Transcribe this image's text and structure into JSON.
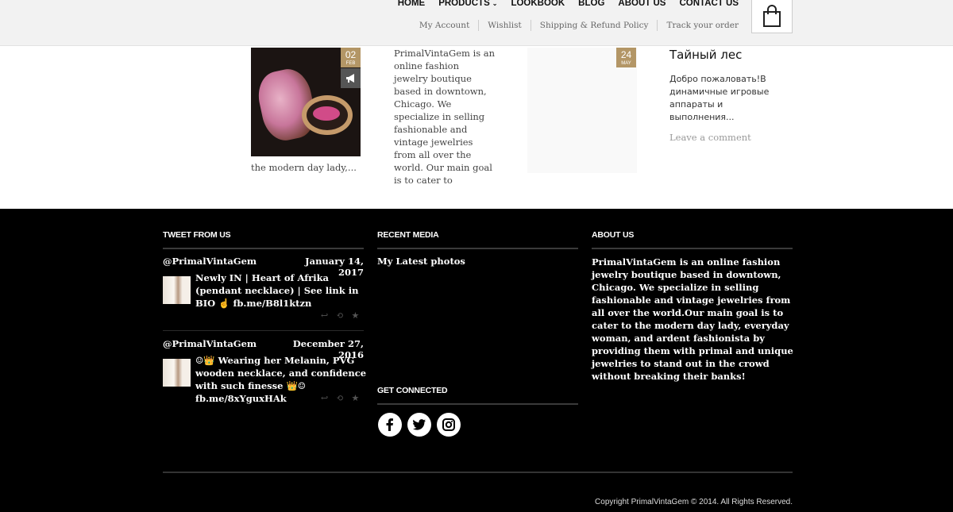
{
  "header": {
    "nav": [
      {
        "label": "HOME"
      },
      {
        "label": "PRODUCTS",
        "caret": "⌄"
      },
      {
        "label": "LOOKBOOK"
      },
      {
        "label": "BLOG"
      },
      {
        "label": "ABOUT US"
      },
      {
        "label": "CONTACT US"
      }
    ],
    "subnav": [
      {
        "label": "My Account"
      },
      {
        "label": "Wishlist"
      },
      {
        "label": "Shipping & Refund Policy"
      },
      {
        "label": "Track your order"
      }
    ],
    "cart_icon": "shopping-bag-icon"
  },
  "posts": {
    "post1": {
      "day": "02",
      "month": "FEB",
      "format_icon": "megaphone-icon",
      "excerpt": "PrimalVintaGem is an online fashion jewelry boutique based in downtown, Chicago. We specialize in selling fashionable and vintage jewelries from all over the world. Our main goal is to cater to",
      "excerpt_cont": "the modern day lady,..."
    },
    "post2": {
      "day": "24",
      "month": "MAY",
      "title": "Тайный лес",
      "text": "Добро пожаловать!В динамичные игровые аппараты и выполнения...",
      "comment_link": "Leave a comment"
    }
  },
  "footer": {
    "tweets": {
      "heading": "TWEET FROM US",
      "items": [
        {
          "handle": "@PrimalVintaGem",
          "date": "January 14, 2017",
          "text": "Newly IN | Heart of Afrika (pendant necklace) | See link in BIO ☝ fb.me/B8l1ktzn"
        },
        {
          "handle": "@PrimalVintaGem",
          "date": "December 27, 2016",
          "text": "☺👑 Wearing her Melanin, PVG wooden necklace, and confidence with such finesse 👑☺ fb.me/8xYguxHAk"
        }
      ],
      "action_icons": [
        "reply-icon",
        "retweet-icon",
        "favorite-icon"
      ]
    },
    "media": {
      "heading": "RECENT MEDIA",
      "link": "My Latest photos"
    },
    "connected": {
      "heading": "GET CONNECTED",
      "icons": [
        "facebook-icon",
        "twitter-icon",
        "instagram-icon"
      ]
    },
    "about": {
      "heading": "ABOUT US",
      "text": "PrimalVintaGem is an online fashion jewelry boutique based in downtown, Chicago. We specialize in selling fashionable and vintage jewelries from all over the world.Our main goal is to cater to the modern day lady, everyday woman, and ardent fashionista by providing them with primal and unique jewelries to stand out in the crowd without breaking their banks!"
    },
    "copyright": "Copyright PrimalVintaGem © 2014. All Rights Reserved."
  },
  "colors": {
    "accent": "#b39666",
    "footer_bg": "#000000",
    "header_bg": "#f2f2f2"
  }
}
